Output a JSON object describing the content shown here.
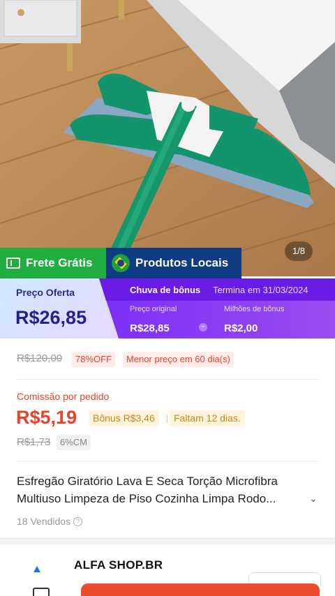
{
  "image": {
    "counter": "1/8"
  },
  "banners": {
    "shipping": "Frete Grátis",
    "local": "Produtos Locais",
    "shipping_icon": "ticket-icon",
    "local_icon": "brazil-flag-icon"
  },
  "price": {
    "offer_label": "Preço Oferta",
    "offer_value": "R$26,85",
    "bonus_title": "Chuva de bônus",
    "ends": "Termina em 31/03/2024",
    "original_label": "Preço original",
    "original_value": "R$28,85",
    "miles_label": "Milhões de bônus",
    "miles_value": "R$2,00"
  },
  "discount": {
    "old_price": "R$120,00",
    "off": "78%OFF",
    "lowest": "Menor preço em 60 dia(s)"
  },
  "commission": {
    "label": "Comissão por pedido",
    "value": "R$5,19",
    "bonus": "Bônus R$3,46",
    "days_left": "Faltam 12 dias.",
    "old": "R$1,73",
    "cm": "6%CM"
  },
  "product": {
    "title_line1": "Esfregão Giratório Lava E Seca Torção Microfibra",
    "title_line2": "Multiuso Limpeza de Piso Cozinha Limpa Rodo...",
    "sold": "18 Vendidos"
  },
  "shop": {
    "name": "ALFA SHOP.BR"
  },
  "colors": {
    "accent_red": "#e8412c",
    "green_banner": "#1fae3f",
    "navy_banner": "#0f3b82",
    "purple": "#7b2ff7"
  }
}
